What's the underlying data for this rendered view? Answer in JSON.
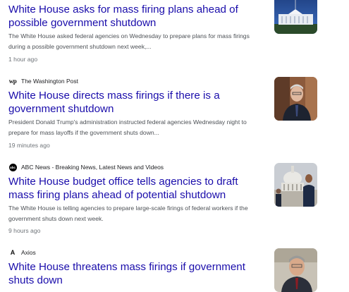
{
  "articles": [
    {
      "source": "",
      "title": "White House asks for mass firing plans ahead of possible government shutdown",
      "snippet": "The White House asked federal agencies on Wednesday to prepare plans for mass firings during a possible government shutdown next week,...",
      "time": "1 hour ago",
      "thumbnail_icon": "white-house-photo"
    },
    {
      "source": "The Washington Post",
      "source_icon": "washington-post-logo",
      "source_icon_text": "wp",
      "title": "White House directs mass firings if there is a government shutdown",
      "snippet": "President Donald Trump's administration instructed federal agencies Wednesday night to prepare for mass layoffs if the government shuts down...",
      "time": "19 minutes ago",
      "thumbnail_icon": "official-portrait-photo"
    },
    {
      "source": "ABC News - Breaking News, Latest News and Videos",
      "source_icon": "abc-news-logo",
      "source_icon_text": "abc",
      "title": "White House budget office tells agencies to draft mass firing plans ahead of potential shutdown",
      "snippet": "The White House is telling agencies to prepare large-scale firings of federal workers if the government shuts down next week.",
      "time": "9 hours ago",
      "thumbnail_icon": "capitol-police-photo"
    },
    {
      "source": "Axios",
      "source_icon": "axios-logo",
      "source_icon_text": "A",
      "title": "White House threatens mass firings if government shuts down",
      "thumbnail_icon": "official-speaking-photo"
    }
  ],
  "colors": {
    "title": "#1a0dab",
    "snippet": "#4d5156",
    "time": "#70757a",
    "source": "#202124"
  }
}
